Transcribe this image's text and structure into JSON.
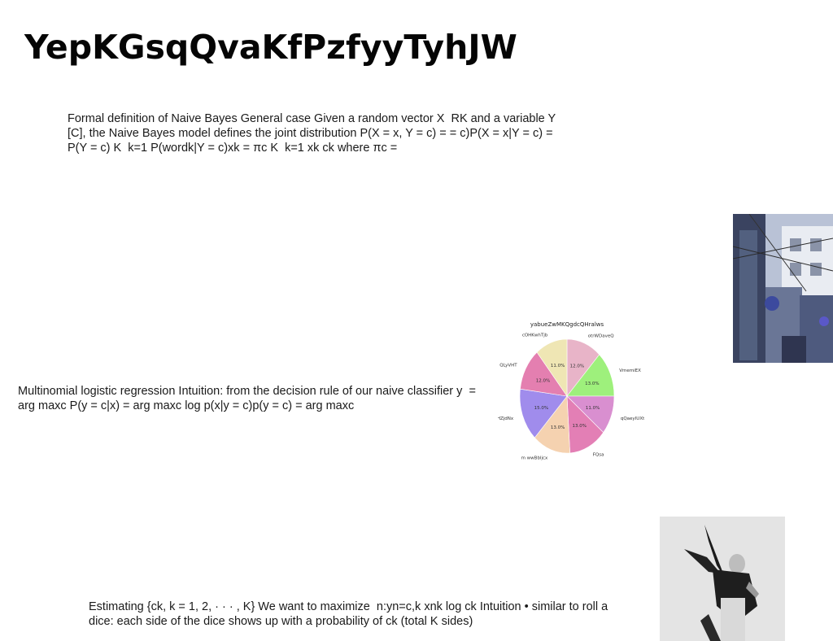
{
  "slide": {
    "title": "YepKGsqQvaKfPzfyyTyhJW",
    "paragraph1": "Formal definition of Naive Bayes General case Given a random vector X \u0002 RK and a variable Y \u0002 [C], the Naive Bayes model defines the joint distribution P(X = x, Y = c) = = c)P(X = x|Y = c) = P(Y = c) K \u0002 k=1 P(wordk|Y = c)xk = πc K \u0002 k=1 \u0002xk ck where πc =",
    "paragraph2": "Multinomial logistic regression Intuition: from the decision rule of our naive classifier y \u0002 = arg maxc P(y = c|x) = arg maxc log p(x|y = c)p(y = c) = arg maxc",
    "paragraph3": "Estimating {\u0002ck, k = 1, 2, · · · , K} We want to maximize \u0002 n:yn=c,k xnk log \u0002ck Intuition • similar to roll a dice: each side of the dice shows up with a probability of \u0002ck (total K sides)"
  },
  "chart_data": {
    "type": "pie",
    "title": "yabueZwMKQgdcQHralws",
    "slices": [
      {
        "label": "otrWDaveQ",
        "value": 12.0,
        "pct_label": "12.0%",
        "color": "#e8b4c8"
      },
      {
        "label": "VmemiEX",
        "value": 13.0,
        "pct_label": "13.0%",
        "color": "#9ef07c"
      },
      {
        "label": "qQaeyIUXtX",
        "value": 11.0,
        "pct_label": "11.0%",
        "color": "#d98fd0"
      },
      {
        "label": "FQsa",
        "value": 13.0,
        "pct_label": "13.0%",
        "color": "#e37fb5"
      },
      {
        "label": "m wwBbljcx",
        "value": 13.0,
        "pct_label": "13.0%",
        "color": "#f5d2b0"
      },
      {
        "label": "HZjdNx",
        "value": 15.0,
        "pct_label": "15.0%",
        "color": "#a08cec"
      },
      {
        "label": "QLyVHT",
        "value": 12.0,
        "pct_label": "12.0%",
        "color": "#e47fb0"
      },
      {
        "label": "cOHKwhTjb",
        "value": 11.0,
        "pct_label": "11.0%",
        "color": "#efe6b4"
      }
    ]
  }
}
